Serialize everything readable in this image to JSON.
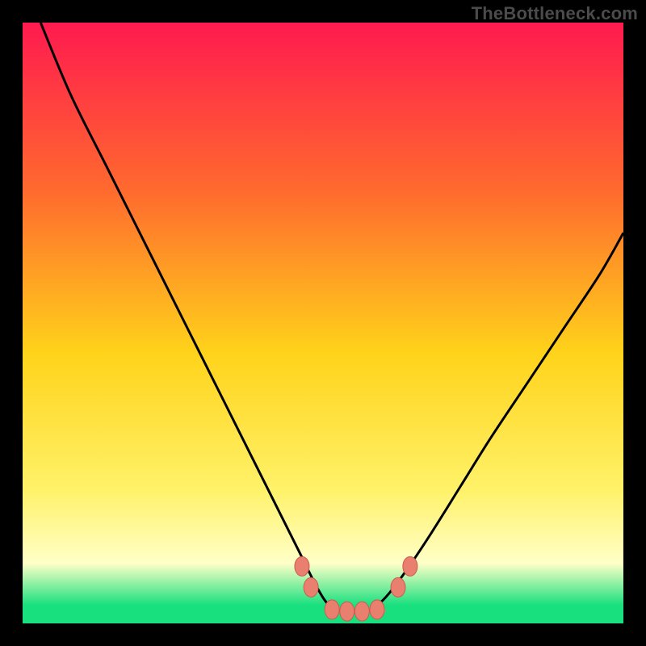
{
  "attribution": "TheBottleneck.com",
  "colors": {
    "frame": "#000000",
    "grad_top": "#ff1a4f",
    "grad_upper": "#ff6a2e",
    "grad_mid": "#ffd31a",
    "grad_lower": "#fff26a",
    "grad_band_light": "#ffffc8",
    "grad_base_green": "#18e07e",
    "curve": "#000000",
    "marker_fill": "#e9806f",
    "marker_stroke": "#ce5a4e"
  },
  "chart_data": {
    "type": "line",
    "title": "",
    "xlabel": "",
    "ylabel": "",
    "xlim": [
      0,
      100
    ],
    "ylim": [
      0,
      100
    ],
    "grid": false,
    "series": [
      {
        "name": "bottleneck-curve",
        "x": [
          3,
          8,
          14,
          20,
          26,
          32,
          38,
          42,
          46,
          49,
          51,
          53,
          55,
          57,
          59,
          61,
          64,
          68,
          73,
          78,
          84,
          90,
          96,
          100
        ],
        "y": [
          100,
          88,
          76,
          64,
          52,
          40,
          28,
          20,
          12,
          6,
          3,
          2,
          2,
          2,
          3,
          5,
          9,
          15,
          23,
          31,
          40,
          49,
          58,
          65
        ]
      }
    ],
    "markers": [
      {
        "x": 46.5,
        "y": 9.5
      },
      {
        "x": 48.0,
        "y": 6.0
      },
      {
        "x": 51.5,
        "y": 2.3
      },
      {
        "x": 54.0,
        "y": 2.0
      },
      {
        "x": 56.5,
        "y": 2.0
      },
      {
        "x": 59.0,
        "y": 2.3
      },
      {
        "x": 62.5,
        "y": 6.0
      },
      {
        "x": 64.5,
        "y": 9.5
      }
    ],
    "flat_segment": {
      "x0": 51,
      "x1": 60,
      "y": 2.1
    }
  }
}
